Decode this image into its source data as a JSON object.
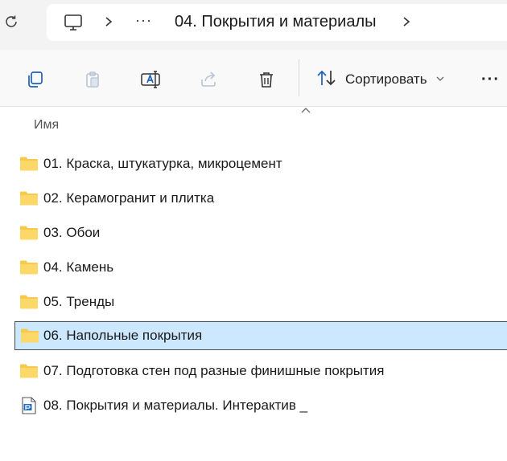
{
  "address_bar": {
    "more_label": "···",
    "current_folder": "04. Покрытия и материалы"
  },
  "toolbar": {
    "sort_label": "Сортировать",
    "more_label": "···"
  },
  "list": {
    "column_name": "Имя",
    "items": [
      {
        "name": "01. Краска, штукатурка, микроцемент",
        "type": "folder"
      },
      {
        "name": "02. Керамогранит и плитка",
        "type": "folder"
      },
      {
        "name": "03. Обои",
        "type": "folder"
      },
      {
        "name": "04. Камень",
        "type": "folder"
      },
      {
        "name": "05. Тренды",
        "type": "folder"
      },
      {
        "name": "06. Напольные покрытия",
        "type": "folder",
        "selected": true
      },
      {
        "name": "07. Подготовка стен под разные финишные покрытия",
        "type": "folder"
      },
      {
        "name": "08. Покрытия и материалы. Интерактив _",
        "type": "file"
      }
    ]
  },
  "colors": {
    "selection": "#cce8ff",
    "folder": "#f8c94a"
  }
}
